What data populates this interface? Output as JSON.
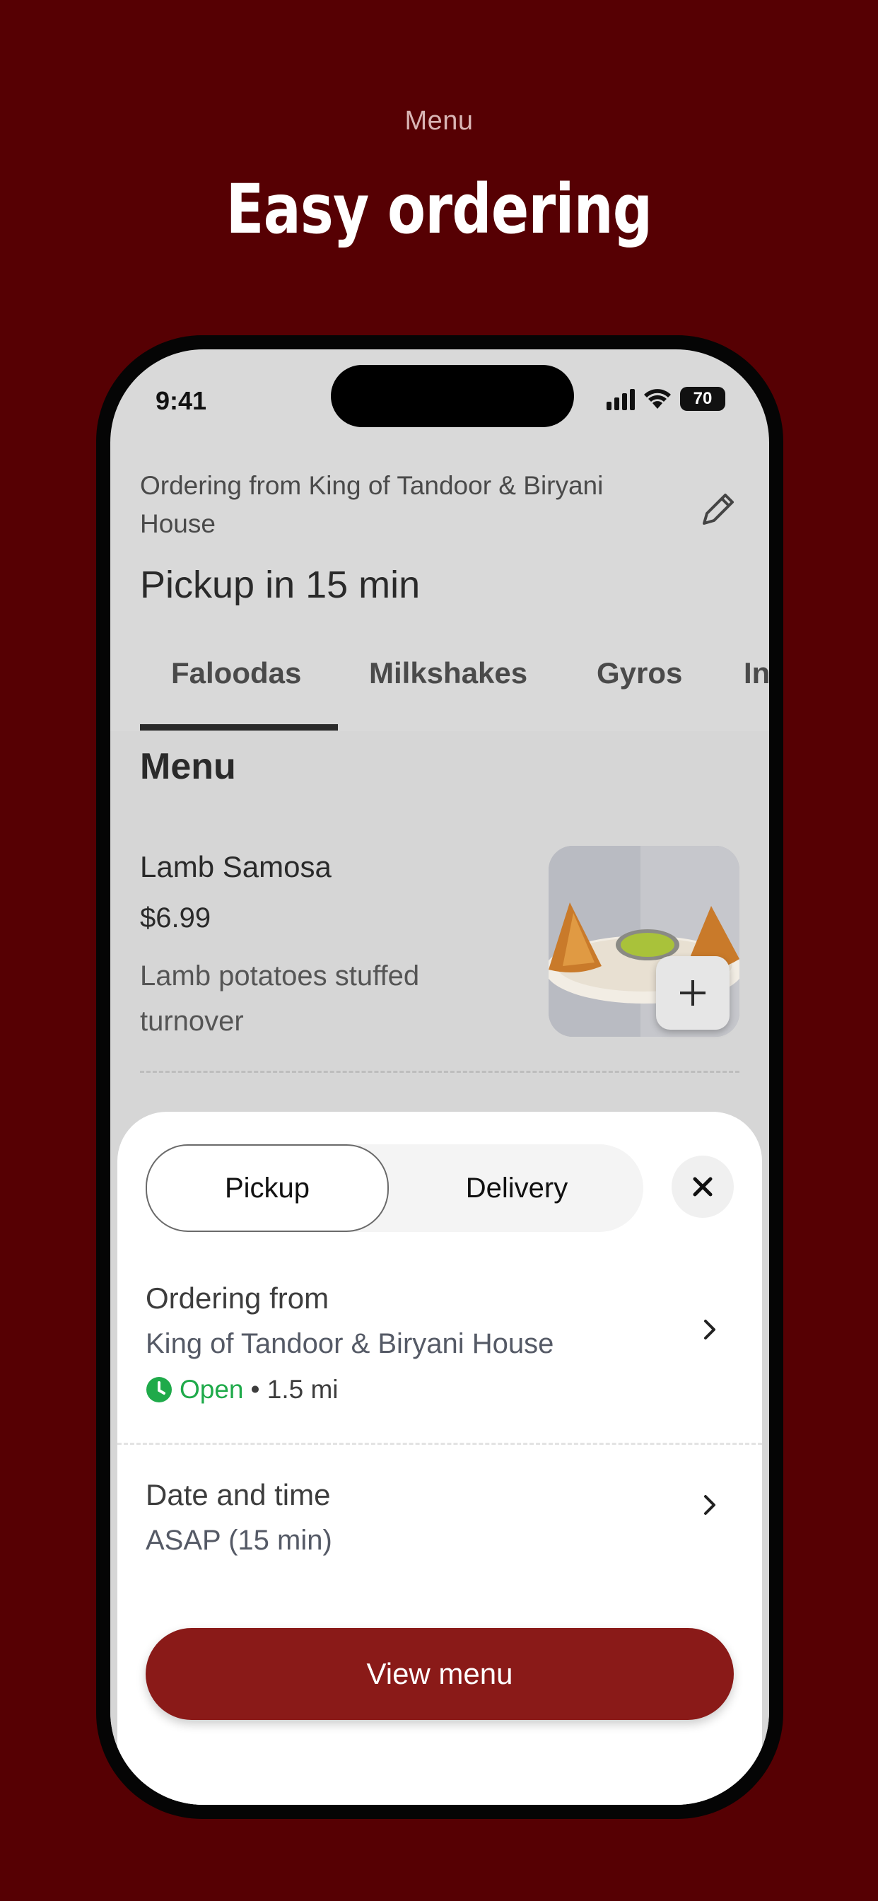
{
  "header": {
    "subtitle": "Menu",
    "title": "Easy ordering"
  },
  "status_bar": {
    "time": "9:41",
    "battery": "70"
  },
  "top": {
    "ordering_from": "Ordering from King of Tandoor & Biryani House",
    "pickup_time": "Pickup in 15 min"
  },
  "tabs": [
    {
      "label": "Faloodas",
      "active": true
    },
    {
      "label": "Milkshakes",
      "active": false
    },
    {
      "label": "Gyros",
      "active": false
    },
    {
      "label": "In",
      "active": false
    }
  ],
  "menu": {
    "heading": "Menu",
    "item": {
      "name": "Lamb Samosa",
      "price": "$6.99",
      "description": "Lamb potatoes stuffed turnover"
    }
  },
  "sheet": {
    "mode_options": [
      "Pickup",
      "Delivery"
    ],
    "selected_mode": "Pickup",
    "ordering_from_label": "Ordering from",
    "restaurant_name": "King of Tandoor & Biryani House",
    "open_status": "Open",
    "distance": "• 1.5 mi",
    "date_time_label": "Date and time",
    "date_time_value": "ASAP (15 min)",
    "view_menu_button": "View menu"
  },
  "colors": {
    "background": "#560003",
    "accent_button": "#8a1a18",
    "open_green": "#1faa4a"
  },
  "icons": [
    "edit-pencil-icon",
    "plus-icon",
    "close-icon",
    "chevron-right-icon",
    "clock-icon",
    "signal-icon",
    "wifi-icon",
    "battery-icon"
  ]
}
